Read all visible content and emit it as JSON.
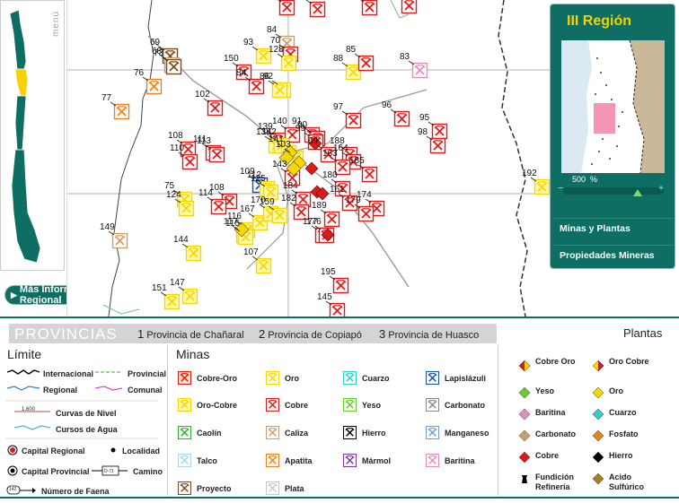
{
  "sidebar": {
    "menu_label": "menú"
  },
  "more_info_button": "Más Información Regional",
  "region_panel": {
    "title": "III Región",
    "zoom_value": "500",
    "zoom_unit": "%",
    "zoom_level": 0.75,
    "buttons": [
      "Minas y Plantas",
      "Propiedades Mineras"
    ]
  },
  "map": {
    "labels": [
      "72",
      "66",
      "56",
      "55",
      "84",
      "150",
      "93",
      "70",
      "88",
      "85",
      "83",
      "128",
      "69",
      "68",
      "73",
      "92",
      "86",
      "76",
      "84",
      "102",
      "97",
      "77",
      "139",
      "140",
      "91",
      "96",
      "95",
      "111",
      "113",
      "138",
      "142",
      "90",
      "99",
      "108",
      "141",
      "98",
      "110",
      "103",
      "69",
      "188",
      "164",
      "192",
      "75",
      "109",
      "163",
      "185",
      "112",
      "125",
      "143",
      "180",
      "124",
      "108",
      "114",
      "161",
      "174",
      "179",
      "184",
      "149",
      "116",
      "117",
      "115",
      "167",
      "170",
      "159",
      "182",
      "189",
      "177",
      "144",
      "176",
      "107",
      "151",
      "147",
      "195",
      "145"
    ]
  },
  "legend": {
    "provincias_title": "PROVINCIAS",
    "provincias": [
      {
        "num": "1",
        "name": "Provincia de Chañaral"
      },
      {
        "num": "2",
        "name": "Provincia de Copiapó"
      },
      {
        "num": "3",
        "name": "Provincia de Huasco"
      }
    ],
    "limite_title": "Límite",
    "limite_items": [
      "Internacional",
      "Provincial",
      "Regional",
      "Comunal",
      "Curvas de Nivel",
      "Cursos de Agua",
      "Capital Regional",
      "Localidad",
      "Capital Provincial",
      "Camino",
      "Número de Faena"
    ],
    "curvas_sample": "1.600",
    "camino_sample": "D-71",
    "faena_sample": "142",
    "minas_title": "Minas",
    "minas": [
      "Cobre-Oro",
      "Oro",
      "Cuarzo",
      "Lapislázuli",
      "Oro-Cobre",
      "Cobre",
      "Yeso",
      "Carbonato",
      "Caolín",
      "Caliza",
      "Hierro",
      "Manganeso",
      "Talco",
      "Apatita",
      "Mármol",
      "Baritina",
      "Proyecto",
      "Plata"
    ],
    "plantas_title": "Plantas",
    "plantas": [
      "Cobre Oro",
      "Oro Cobre",
      "Yeso",
      "Oro",
      "Baritina",
      "Cuarzo",
      "Carbonato",
      "Fosfato",
      "Cobre",
      "Hierro",
      "Fundición Refinería",
      "Acido Sulfúrico"
    ],
    "colors": {
      "accent": "#0e6e63",
      "title_yellow": "#f5d200",
      "cobre": "#d81c1c",
      "oro": "#f5d800",
      "cuarzo": "#33cccc",
      "lapislazuli": "#1a4fa0",
      "yeso": "#66cc33",
      "carbonato": "#888888",
      "caolin": "#2db32d",
      "caliza": "#c8a070",
      "hierro": "#000000",
      "manganeso": "#6aa0d0",
      "talco": "#a8d8e8",
      "apatita": "#e8821e",
      "marmol": "#7a3a9a",
      "baritina": "#e090c0",
      "proyecto": "#7a4a1a",
      "plata": "#c8c8c8"
    }
  }
}
